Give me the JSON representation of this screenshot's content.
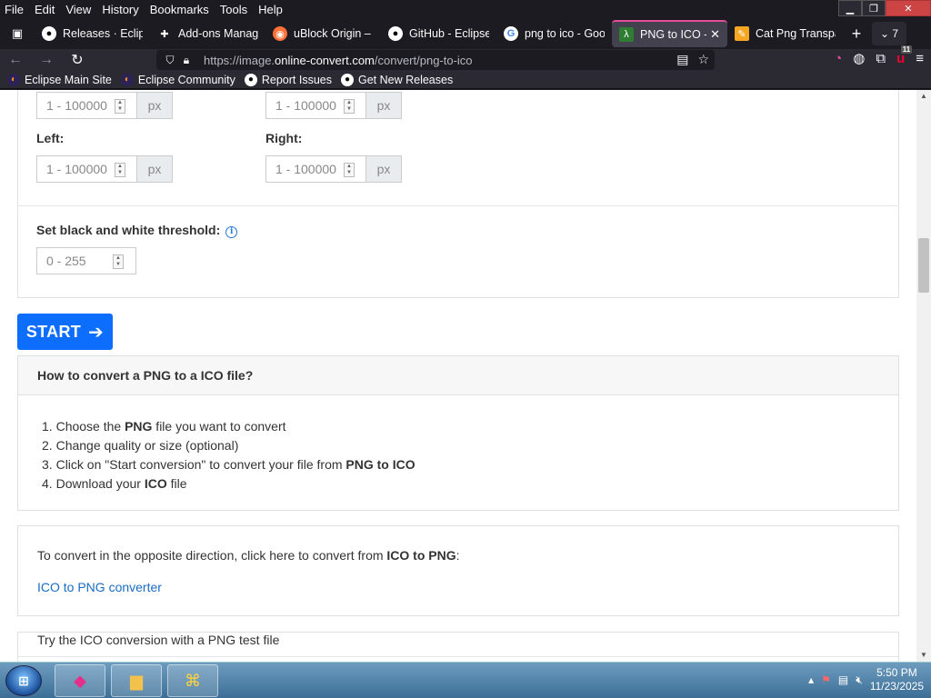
{
  "menubar": {
    "items": [
      "File",
      "Edit",
      "View",
      "History",
      "Bookmarks",
      "Tools",
      "Help"
    ]
  },
  "tabs": [
    {
      "label": "Releases · Eclipse",
      "icon": "github-icon"
    },
    {
      "label": "Add-ons Manager",
      "icon": "puzzle-icon"
    },
    {
      "label": "uBlock Origin –",
      "icon": "firefox-icon"
    },
    {
      "label": "GitHub - Eclipse",
      "icon": "github-icon"
    },
    {
      "label": "png to ico - Goo",
      "icon": "google-icon"
    },
    {
      "label": "PNG to ICO -",
      "icon": "online-convert-icon",
      "active": true,
      "close": "✕"
    },
    {
      "label": "Cat Png Transpa",
      "icon": "image-icon"
    }
  ],
  "tab_count": "7",
  "url": {
    "prefix": "https://image.",
    "host": "online-convert.com",
    "path": "/convert/png-to-ico"
  },
  "bookmarks": [
    {
      "label": "Eclipse Main Site",
      "icon": "eclipse-icon"
    },
    {
      "label": "Eclipse Community",
      "icon": "eclipse-icon"
    },
    {
      "label": "Report Issues",
      "icon": "github-icon"
    },
    {
      "label": "Get New Releases",
      "icon": "github-icon"
    }
  ],
  "ublock_count": "11",
  "options": {
    "left_label": "Left:",
    "right_label": "Right:",
    "range_placeholder": "1 - 100000",
    "unit": "px",
    "threshold_label": "Set black and white threshold:",
    "threshold_placeholder": "0 - 255"
  },
  "start_label": "START",
  "howto": {
    "title": "How to convert a PNG to a ICO file?",
    "steps": [
      {
        "n": "1.",
        "pre": "Choose the ",
        "b": "PNG",
        "post": " file you want to convert"
      },
      {
        "n": "2.",
        "pre": "Change quality or size (optional)",
        "b": "",
        "post": ""
      },
      {
        "n": "3.",
        "pre": "Click on \"Start conversion\" to convert your file from ",
        "b": "PNG to ICO",
        "post": ""
      },
      {
        "n": "4.",
        "pre": "Download your ",
        "b": "ICO",
        "post": " file"
      }
    ]
  },
  "opposite": {
    "text_pre": "To convert in the opposite direction, click here to convert from ",
    "text_b": "ICO to PNG",
    "text_post": ":",
    "link": "ICO to PNG converter"
  },
  "try_text": "Try the ICO conversion with a PNG test file",
  "clock": {
    "time": "5:50 PM",
    "date": "11/23/2025"
  }
}
